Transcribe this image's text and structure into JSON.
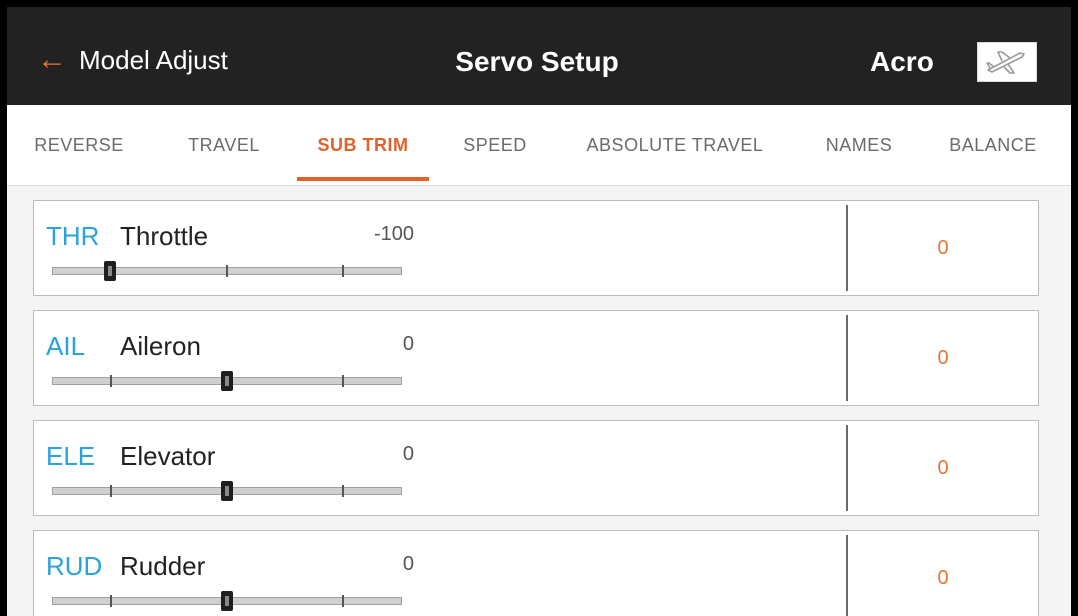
{
  "header": {
    "back_label": "Model Adjust",
    "title": "Servo Setup",
    "model_name": "Acro",
    "model_icon": "airplane-icon"
  },
  "tabs": [
    {
      "label": "REVERSE",
      "active": false
    },
    {
      "label": "TRAVEL",
      "active": false
    },
    {
      "label": "SUB TRIM",
      "active": true
    },
    {
      "label": "SPEED",
      "active": false
    },
    {
      "label": "ABSOLUTE TRAVEL",
      "active": false
    },
    {
      "label": "NAMES",
      "active": false
    },
    {
      "label": "BALANCE",
      "active": false
    }
  ],
  "channels": [
    {
      "abbr": "THR",
      "name": "Throttle",
      "value": "-100",
      "position": -100,
      "subtrim": "0"
    },
    {
      "abbr": "AIL",
      "name": "Aileron",
      "value": "0",
      "position": 0,
      "subtrim": "0"
    },
    {
      "abbr": "ELE",
      "name": "Elevator",
      "value": "0",
      "position": 0,
      "subtrim": "0"
    },
    {
      "abbr": "RUD",
      "name": "Rudder",
      "value": "0",
      "position": 0,
      "subtrim": "0"
    }
  ],
  "colors": {
    "accent": "#e0622a",
    "channel_abbr": "#2aa2dc",
    "header_bg": "#222222"
  }
}
